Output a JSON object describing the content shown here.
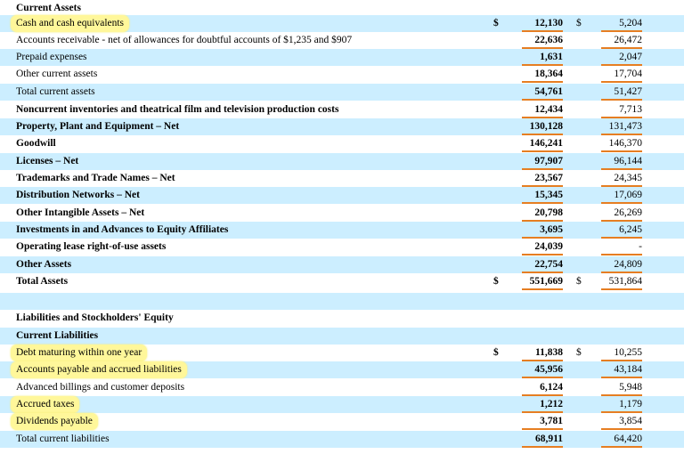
{
  "header": {
    "title": "Current Assets"
  },
  "rows": [
    {
      "label": "Cash and cash equivalents",
      "d1": "$",
      "v1": "12,130",
      "d2": "$",
      "v2": "5,204"
    },
    {
      "label": "Accounts receivable - net of allowances for doubtful accounts of $1,235 and $907",
      "d1": "",
      "v1": "22,636",
      "d2": "",
      "v2": "26,472"
    },
    {
      "label": "Prepaid expenses",
      "d1": "",
      "v1": "1,631",
      "d2": "",
      "v2": "2,047"
    },
    {
      "label": "Other current assets",
      "d1": "",
      "v1": "18,364",
      "d2": "",
      "v2": "17,704"
    },
    {
      "label": "Total current assets",
      "d1": "",
      "v1": "54,761",
      "d2": "",
      "v2": "51,427"
    },
    {
      "label": "Noncurrent inventories and theatrical film and television production costs",
      "d1": "",
      "v1": "12,434",
      "d2": "",
      "v2": "7,713"
    },
    {
      "label": "Property, Plant and Equipment – Net",
      "d1": "",
      "v1": "130,128",
      "d2": "",
      "v2": "131,473"
    },
    {
      "label": "Goodwill",
      "d1": "",
      "v1": "146,241",
      "d2": "",
      "v2": "146,370"
    },
    {
      "label": "Licenses – Net",
      "d1": "",
      "v1": "97,907",
      "d2": "",
      "v2": "96,144"
    },
    {
      "label": "Trademarks and Trade Names – Net",
      "d1": "",
      "v1": "23,567",
      "d2": "",
      "v2": "24,345"
    },
    {
      "label": "Distribution Networks – Net",
      "d1": "",
      "v1": "15,345",
      "d2": "",
      "v2": "17,069"
    },
    {
      "label": "Other Intangible Assets – Net",
      "d1": "",
      "v1": "20,798",
      "d2": "",
      "v2": "26,269"
    },
    {
      "label": "Investments in and Advances to Equity Affiliates",
      "d1": "",
      "v1": "3,695",
      "d2": "",
      "v2": "6,245"
    },
    {
      "label": "Operating lease right-of-use assets",
      "d1": "",
      "v1": "24,039",
      "d2": "",
      "v2": "-"
    },
    {
      "label": "Other Assets",
      "d1": "",
      "v1": "22,754",
      "d2": "",
      "v2": "24,809"
    },
    {
      "label": "Total Assets",
      "d1": "$",
      "v1": "551,669",
      "d2": "$",
      "v2": "531,864"
    },
    {
      "label": "",
      "d1": "",
      "v1": "",
      "d2": "",
      "v2": ""
    },
    {
      "label": "Liabilities and Stockholders' Equity",
      "d1": "",
      "v1": "",
      "d2": "",
      "v2": ""
    },
    {
      "label": "Current Liabilities",
      "d1": "",
      "v1": "",
      "d2": "",
      "v2": ""
    },
    {
      "label": "Debt maturing within one year",
      "d1": "$",
      "v1": "11,838",
      "d2": "$",
      "v2": "10,255"
    },
    {
      "label": "Accounts payable and accrued liabilities",
      "d1": "",
      "v1": "45,956",
      "d2": "",
      "v2": "43,184"
    },
    {
      "label": "Advanced billings and customer deposits",
      "d1": "",
      "v1": "6,124",
      "d2": "",
      "v2": "5,948"
    },
    {
      "label": "Accrued taxes",
      "d1": "",
      "v1": "1,212",
      "d2": "",
      "v2": "1,179"
    },
    {
      "label": "Dividends payable",
      "d1": "",
      "v1": "3,781",
      "d2": "",
      "v2": "3,854"
    },
    {
      "label": "Total current liabilities",
      "d1": "",
      "v1": "68,911",
      "d2": "",
      "v2": "64,420"
    }
  ],
  "colors": {
    "shade": "#cceeff",
    "highlight": "#fff79a",
    "underline": "#e67e22"
  }
}
